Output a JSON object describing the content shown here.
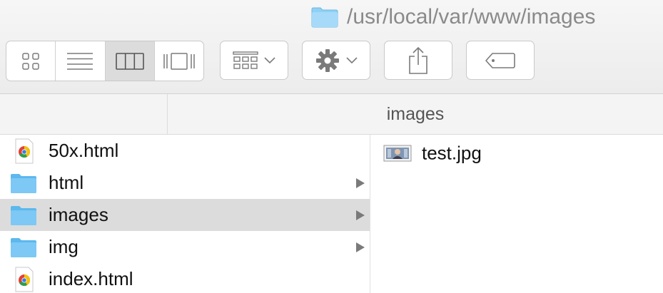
{
  "window": {
    "path_title": "/usr/local/var/www/images"
  },
  "toolbar": {
    "view_modes": [
      {
        "name": "icon-view",
        "active": false
      },
      {
        "name": "list-view",
        "active": false
      },
      {
        "name": "column-view",
        "active": true
      },
      {
        "name": "cover-flow-view",
        "active": false
      }
    ],
    "buttons": [
      "arrange",
      "action",
      "share",
      "tags"
    ]
  },
  "column_header": {
    "title": "images"
  },
  "column1": {
    "items": [
      {
        "label": "50x.html",
        "type": "html-file",
        "has_children": false,
        "selected": false
      },
      {
        "label": "html",
        "type": "folder",
        "has_children": true,
        "selected": false
      },
      {
        "label": "images",
        "type": "folder",
        "has_children": true,
        "selected": true
      },
      {
        "label": "img",
        "type": "folder",
        "has_children": true,
        "selected": false
      },
      {
        "label": "index.html",
        "type": "html-file",
        "has_children": false,
        "selected": false
      }
    ]
  },
  "column2": {
    "items": [
      {
        "label": "test.jpg",
        "type": "image-file"
      }
    ]
  },
  "colors": {
    "folder": "#6fc3f3",
    "selection": "#dcdcdc",
    "toolbar": "#ececec"
  }
}
